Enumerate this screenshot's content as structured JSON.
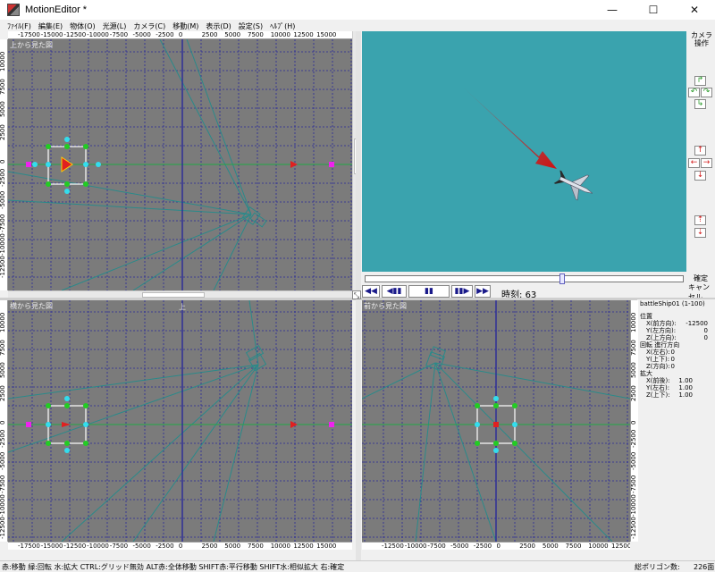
{
  "window": {
    "title": "MotionEditor *",
    "minimize": "—",
    "maximize": "☐",
    "close": "✕"
  },
  "menu": [
    "ﾌｧｲﾙ(F)",
    "編集(E)",
    "物体(O)",
    "光源(L)",
    "カメラ(C)",
    "移動(M)",
    "表示(D)",
    "設定(S)",
    "ﾍﾙﾌﾟ(H)"
  ],
  "views": {
    "top": {
      "title": "上から見た図"
    },
    "side": {
      "title": "横から見た図"
    },
    "front": {
      "title": "前から見た図"
    }
  },
  "ruler": {
    "h_main": [
      "-17500",
      "-15000",
      "-12500",
      "-10000",
      "-7500",
      "-5000",
      "-2500",
      "0",
      "2500",
      "5000",
      "7500",
      "10000",
      "12500",
      "15000"
    ],
    "h_front": [
      "-12500",
      "-10000",
      "-7500",
      "-5000",
      "-2500",
      "0",
      "2500",
      "5000",
      "7500",
      "10000",
      "12500"
    ],
    "v_top": [
      "10000",
      "7500",
      "5000",
      "2500",
      "0",
      "-2500",
      "-5000",
      "-7500",
      "-10000",
      "-12500"
    ],
    "v_side": [
      "10000",
      "7500",
      "5000",
      "2500",
      "0",
      "-2500",
      "-5000",
      "-7500",
      "-10000",
      "-12500"
    ]
  },
  "markers": {
    "up": "上"
  },
  "camera_panel": {
    "label_line1": "カメラ",
    "label_line2": "操作",
    "confirm": "確定",
    "cancel": "キャンセル"
  },
  "playback": {
    "time_label": "時刻:",
    "time_value": "63",
    "timeline_position": 0.62,
    "buttons": [
      "◀◀",
      "◀▮▮",
      "▮▮",
      "▮▮▶",
      "▶▶"
    ]
  },
  "info": {
    "object_name": "battleShip01 (1-100)",
    "position_header": "位置",
    "position": [
      {
        "label": "X(前方向):",
        "value": "-12500"
      },
      {
        "label": "Y(左方向):",
        "value": "0"
      },
      {
        "label": "Z(上方向):",
        "value": "0"
      }
    ],
    "rotation_header": "回転 進行方向",
    "rotation": [
      {
        "label": "X(左右):",
        "value": "0"
      },
      {
        "label": "Y(上下):",
        "value": "0"
      },
      {
        "label": "Z(方向):",
        "value": "0"
      }
    ],
    "scale_header": "拡大",
    "scale": [
      {
        "label": "X(前後):",
        "value": "1.00"
      },
      {
        "label": "Y(左右):",
        "value": "1.00"
      },
      {
        "label": "Z(上下):",
        "value": "1.00"
      }
    ]
  },
  "status": {
    "hint": "赤:移動 緑:回転 水:拡大 CTRL:グリッド無効 ALT赤:全体移動 SHIFT赤:平行移動 SHIFT水:相似拡大 右:確定",
    "polygon_label": "総ポリゴン数:",
    "polygon_count": "226面"
  },
  "colors": {
    "grid_bg": "#7b7b7b",
    "grid_line": "#2a2a9a",
    "camera_bg": "#3aa3ae",
    "accent_red": "#e02020",
    "handle_green": "#22cc22",
    "handle_cyan": "#33ddee",
    "handle_magenta": "#ee22ee"
  }
}
